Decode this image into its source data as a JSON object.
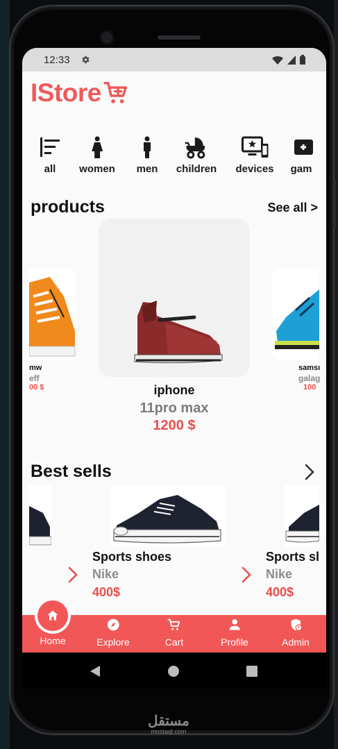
{
  "status": {
    "time": "12:33"
  },
  "brand": {
    "logo": "IStore",
    "cart_icon": "cart-icon",
    "accent": "#ee5a5a"
  },
  "categories": [
    {
      "label": "all",
      "icon": "sort-icon"
    },
    {
      "label": "women",
      "icon": "woman-icon"
    },
    {
      "label": "men",
      "icon": "man-icon"
    },
    {
      "label": "children",
      "icon": "stroller-icon"
    },
    {
      "label": "devices",
      "icon": "devices-icon"
    },
    {
      "label": "gam",
      "icon": "games-icon"
    }
  ],
  "products": {
    "title": "products",
    "see_all": "See all >",
    "left": {
      "name": "mw",
      "sub": "eff",
      "price": "00 $"
    },
    "center": {
      "name": "iphone",
      "sub": "11pro max",
      "price": "1200 $"
    },
    "right": {
      "name": "samsı",
      "sub": "galag",
      "price": "100"
    }
  },
  "best_sells": {
    "title": "Best sells",
    "items": [
      {
        "title": "Sports shoes",
        "brand": "Nike",
        "price": "400$"
      },
      {
        "title": "Sports sl",
        "brand": "Nike",
        "price": "400$"
      }
    ]
  },
  "bottom_nav": [
    {
      "label": "Home",
      "icon": "home-icon",
      "active": true
    },
    {
      "label": "Explore",
      "icon": "compass-icon"
    },
    {
      "label": "Cart",
      "icon": "cart-icon"
    },
    {
      "label": "Profile",
      "icon": "person-icon"
    },
    {
      "label": "Admin",
      "icon": "admin-shield-icon"
    }
  ],
  "watermark": {
    "arabic": "مستقل",
    "latin": "mostaql.com"
  }
}
